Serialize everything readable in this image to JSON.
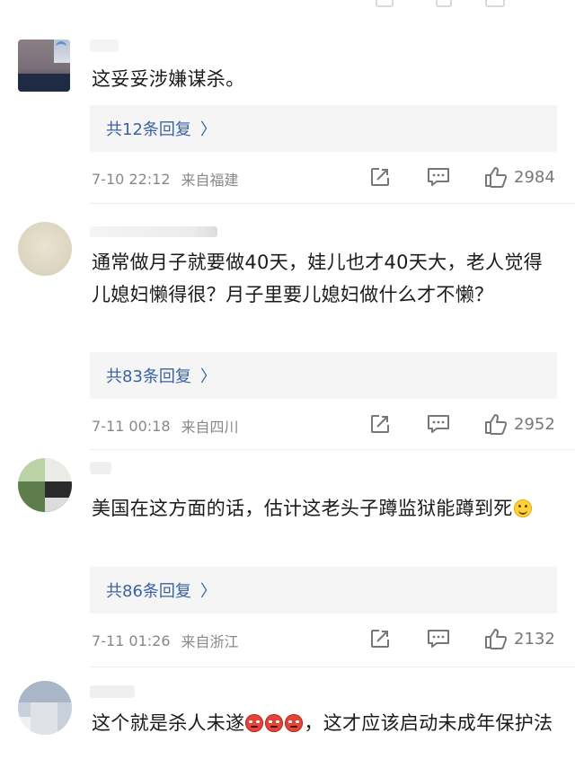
{
  "comments": [
    {
      "text": "这妥妥涉嫌谋杀。",
      "reply_label": "共12条回复",
      "time": "7-10 22:12",
      "location": "来自福建",
      "likes": "2984"
    },
    {
      "text": "通常做月子就要做40天，娃儿也才40天大，老人觉得儿媳妇懒得很？月子里要儿媳妇做什么才不懒？",
      "reply_label": "共83条回复",
      "time": "7-11 00:18",
      "location": "来自四川",
      "likes": "2952"
    },
    {
      "text": "美国在这方面的话，估计这老头子蹲监狱能蹲到死",
      "reply_label": "共86条回复",
      "time": "7-11 01:26",
      "location": "来自浙江",
      "likes": "2132"
    },
    {
      "text_before": "这个就是杀人未遂",
      "text_after": "，这才应该启动未成年保护法"
    }
  ],
  "icons": {
    "share": "share-icon",
    "comment": "comment-icon",
    "like": "thumbs-up-icon",
    "reply_chevron": "chevron-right-icon",
    "smile_emoji": "smile-emoji-icon",
    "angry_emoji": "angry-emoji-icon"
  },
  "colors": {
    "reply_link": "#3a62a3",
    "meta_text": "#888888",
    "reply_bg": "#f5f5f5"
  }
}
